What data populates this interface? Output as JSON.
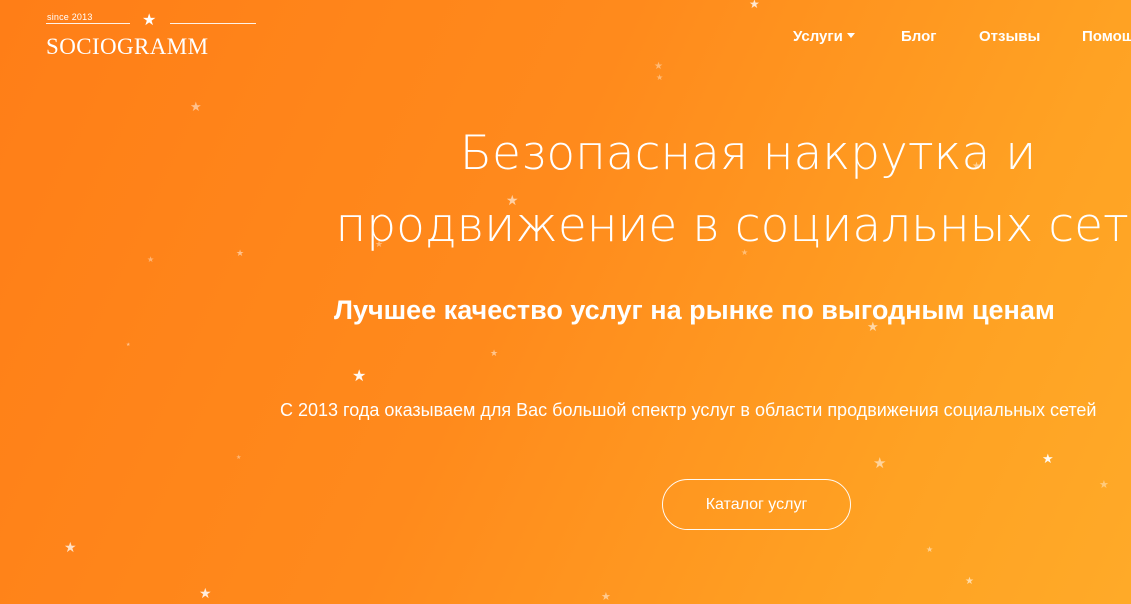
{
  "logo": {
    "since": "since 2013",
    "name": "SOCIOGRAMM",
    "star_icon": "star-icon"
  },
  "nav": {
    "services": "Услуги",
    "blog": "Блог",
    "reviews": "Отзывы",
    "help": "Помощь"
  },
  "hero": {
    "title_line1": "Безопасная накрутка и",
    "title_line2": "продвижение в социальных сетях",
    "subtitle": "Лучшее качество услуг на рынке по выгодным ценам",
    "text": "С 2013 года оказываем для Вас большой спектр услуг в области продвижения социальных сетей",
    "cta": "Каталог услуг"
  },
  "colors": {
    "background_start": "#ff7e17",
    "background_end": "#ffaa28",
    "text": "#ffffff"
  }
}
